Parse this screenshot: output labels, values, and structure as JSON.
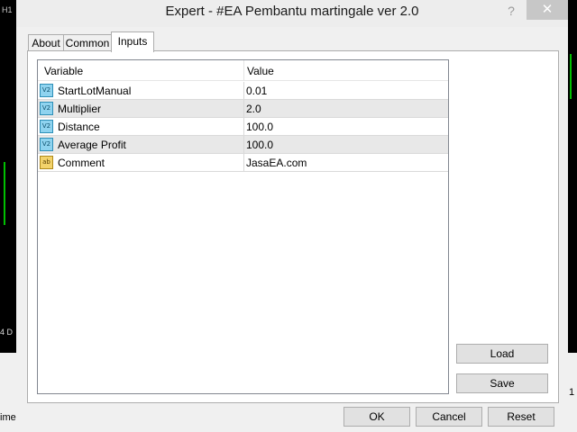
{
  "background": {
    "chart_label": "H1",
    "timeframe_label": "4 D",
    "left_status": "ime",
    "right_status": "1"
  },
  "window": {
    "title": "Expert - #EA Pembantu martingale ver 2.0",
    "help_glyph": "?",
    "close_glyph": "✕"
  },
  "tabs": [
    {
      "label": "About"
    },
    {
      "label": "Common"
    },
    {
      "label": "Inputs"
    }
  ],
  "inputs_table": {
    "headers": {
      "variable": "Variable",
      "value": "Value"
    },
    "rows": [
      {
        "icon": "V2",
        "icon_type": "numeric",
        "name": "StartLotManual",
        "value": "0.01"
      },
      {
        "icon": "V2",
        "icon_type": "numeric",
        "name": "Multiplier",
        "value": "2.0"
      },
      {
        "icon": "V2",
        "icon_type": "numeric",
        "name": "Distance",
        "value": "100.0"
      },
      {
        "icon": "V2",
        "icon_type": "numeric",
        "name": "Average Profit",
        "value": "100.0"
      },
      {
        "icon": "ab",
        "icon_type": "string",
        "name": "Comment",
        "value": "JasaEA.com"
      }
    ]
  },
  "side_buttons": {
    "load": "Load",
    "save": "Save"
  },
  "footer_buttons": {
    "ok": "OK",
    "cancel": "Cancel",
    "reset": "Reset"
  },
  "colors": {
    "numeric_icon": "#8fd3ef",
    "string_icon": "#f3d36b",
    "chart_candle": "#00c000"
  }
}
